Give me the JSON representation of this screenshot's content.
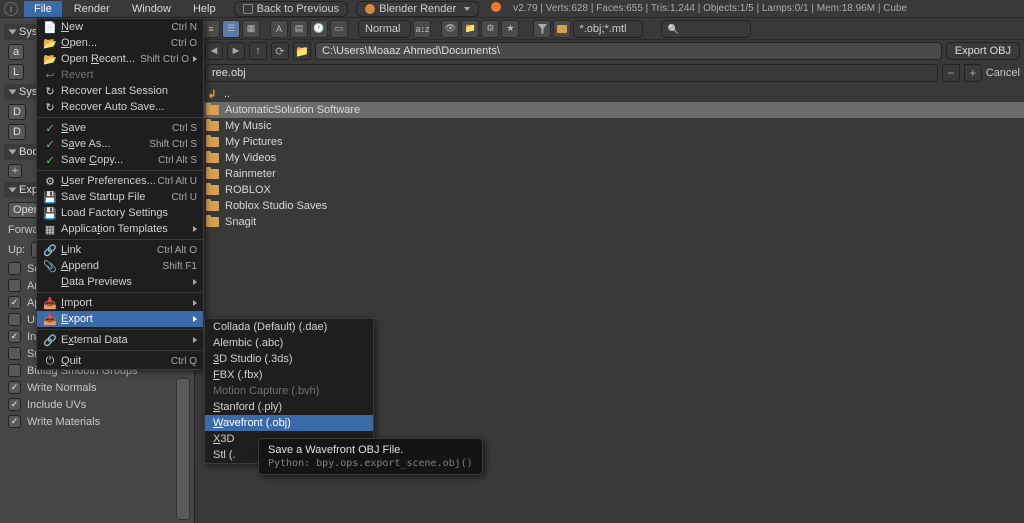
{
  "menubar": {
    "items": [
      "File",
      "Render",
      "Window",
      "Help"
    ],
    "active_index": 0,
    "back_btn": "Back to Previous",
    "engine": "Blender Render",
    "version": "v2.79",
    "stats": "Verts:628 | Faces:655 | Tris:1,244 | Objects:1/5 | Lamps:0/1 | Mem:18.96M | Cube"
  },
  "toolbar": {
    "display_mode": "Normal",
    "sort_label": "a↕z",
    "filter_text": "*.obj;*.mtl"
  },
  "path": {
    "value": "C:\\Users\\Moaaz Ahmed\\Documents\\",
    "export_btn": "Export OBJ"
  },
  "filename": {
    "value": "ree.obj",
    "cancel_btn": "Cancel"
  },
  "browser": {
    "up": "..",
    "items": [
      {
        "label": "AutomaticSolution Software",
        "sel": true
      },
      {
        "label": "My Music",
        "sel": false
      },
      {
        "label": "My Pictures",
        "sel": false
      },
      {
        "label": "My Videos",
        "sel": false
      },
      {
        "label": "Rainmeter",
        "sel": false
      },
      {
        "label": "ROBLOX",
        "sel": false
      },
      {
        "label": "Roblox Studio Saves",
        "sel": false
      },
      {
        "label": "Snagit",
        "sel": false
      }
    ]
  },
  "left_panel": {
    "headers": [
      "System",
      "System",
      "Bookmarks",
      "Export OBJ"
    ],
    "operator_label": "Operator Presets",
    "forward_label": "Forward:",
    "up_label": "Up:",
    "options": [
      {
        "k": "selection",
        "label": "Selection Only",
        "on": false
      },
      {
        "k": "animation",
        "label": "Animation",
        "on": false
      },
      {
        "k": "modifiers",
        "label": "Apply Modifiers",
        "on": true
      },
      {
        "k": "render_settings",
        "label": "Use Modifiers Render Settings",
        "on": false
      },
      {
        "k": "edges",
        "label": "Include Edges",
        "on": true
      },
      {
        "k": "smooth",
        "label": "Smooth Groups",
        "on": false
      },
      {
        "k": "bitflag",
        "label": "Bitflag Smooth Groups",
        "on": false
      },
      {
        "k": "normals",
        "label": "Write Normals",
        "on": true
      },
      {
        "k": "uvs",
        "label": "Include UVs",
        "on": true
      },
      {
        "k": "materials",
        "label": "Write Materials",
        "on": true
      }
    ]
  },
  "file_menu": {
    "rows": [
      {
        "icon": "📄",
        "label": "New",
        "short": "Ctrl N",
        "under": "N"
      },
      {
        "icon": "📂",
        "label": "Open...",
        "short": "Ctrl O",
        "under": "O"
      },
      {
        "icon": "📂",
        "label": "Open Recent...",
        "short": "Shift Ctrl O",
        "sub": true,
        "under": "R"
      },
      {
        "icon": "↩",
        "label": "Revert",
        "disabled": true
      },
      {
        "icon": "↻",
        "label": "Recover Last Session"
      },
      {
        "icon": "↻",
        "label": "Recover Auto Save..."
      },
      {
        "sep": true
      },
      {
        "icon": "✓",
        "label": "Save",
        "short": "Ctrl S",
        "under": "S",
        "iconColor": "#6cc86c"
      },
      {
        "icon": "✓",
        "label": "Save As...",
        "short": "Shift Ctrl S",
        "under": "A",
        "iconColor": "#6cc86c"
      },
      {
        "icon": "✓",
        "label": "Save Copy...",
        "short": "Ctrl Alt S",
        "under": "C",
        "iconColor": "#6cc86c"
      },
      {
        "sep": true
      },
      {
        "icon": "⚙",
        "label": "User Preferences...",
        "short": "Ctrl Alt U",
        "under": "U"
      },
      {
        "icon": "💾",
        "label": "Save Startup File",
        "short": "Ctrl U"
      },
      {
        "icon": "💾",
        "label": "Load Factory Settings"
      },
      {
        "icon": "▦",
        "label": "Application Templates",
        "sub": true,
        "under": "T"
      },
      {
        "sep": true
      },
      {
        "icon": "🔗",
        "label": "Link",
        "short": "Ctrl Alt O",
        "under": "L"
      },
      {
        "icon": "📎",
        "label": "Append",
        "short": "Shift F1",
        "under": "A"
      },
      {
        "icon": "",
        "label": "Data Previews",
        "sub": true,
        "under": "D"
      },
      {
        "sep": true
      },
      {
        "icon": "📥",
        "label": "Import",
        "sub": true,
        "under": "I"
      },
      {
        "icon": "📤",
        "label": "Export",
        "sub": true,
        "hl": true,
        "under": "E"
      },
      {
        "sep": true
      },
      {
        "icon": "🔗",
        "label": "External Data",
        "sub": true,
        "under": "x"
      },
      {
        "sep": true
      },
      {
        "icon": "⏻",
        "label": "Quit",
        "short": "Ctrl Q",
        "under": "Q"
      }
    ]
  },
  "export_menu": {
    "rows": [
      {
        "label": "Collada (Default) (.dae)"
      },
      {
        "label": "Alembic (.abc)"
      },
      {
        "label": "3D Studio (.3ds)",
        "under": "3"
      },
      {
        "label": "FBX (.fbx)",
        "under": "F"
      },
      {
        "label": "Motion Capture (.bvh)",
        "disabled": true
      },
      {
        "label": "Stanford (.ply)",
        "under": "S"
      },
      {
        "label": "Wavefront (.obj)",
        "hl": true,
        "under": "W"
      },
      {
        "label": "X3D Extensible 3D (.x3d)",
        "under": "X",
        "trunc": "X3D"
      },
      {
        "label": "Stl (.stl)",
        "trunc": "Stl (."
      }
    ]
  },
  "tooltip": {
    "title": "Save a Wavefront OBJ File.",
    "py": "Python: bpy.ops.export_scene.obj()"
  }
}
